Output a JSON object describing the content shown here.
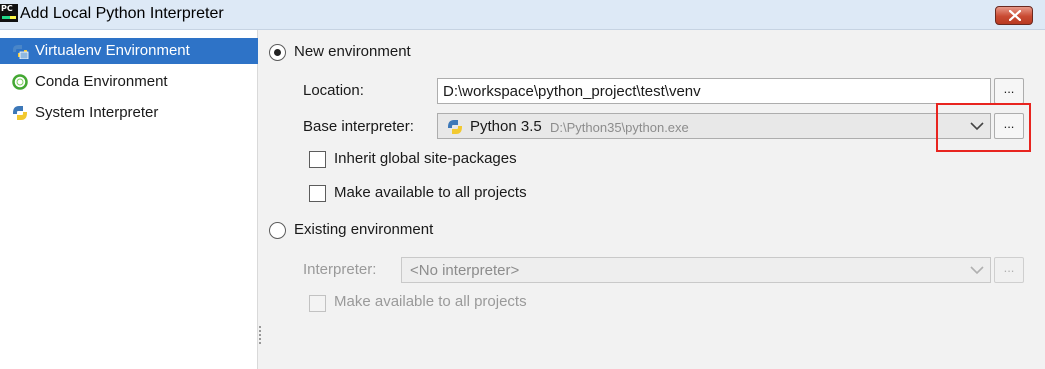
{
  "window": {
    "title": "Add Local Python Interpreter",
    "app_icon_text": "PC"
  },
  "sidebar": {
    "items": [
      {
        "label": "Virtualenv Environment",
        "icon": "virtualenv-icon",
        "selected": true
      },
      {
        "label": "Conda Environment",
        "icon": "conda-icon",
        "selected": false
      },
      {
        "label": "System Interpreter",
        "icon": "python-icon",
        "selected": false
      }
    ]
  },
  "new_env": {
    "radio_label": "New environment",
    "selected": true,
    "location_label": "Location:",
    "location_value": "D:\\workspace\\python_project\\test\\venv",
    "browse_label": "...",
    "base_interpreter_label": "Base interpreter:",
    "base_interpreter_name": "Python 3.5",
    "base_interpreter_path": "D:\\Python35\\python.exe",
    "inherit_label": "Inherit global site-packages",
    "inherit_checked": false,
    "make_available_label": "Make available to all projects",
    "make_available_checked": false
  },
  "existing_env": {
    "radio_label": "Existing environment",
    "selected": false,
    "interpreter_label": "Interpreter:",
    "interpreter_value": "<No interpreter>",
    "browse_label": "...",
    "make_available_label": "Make available to all projects",
    "make_available_checked": false
  },
  "colors": {
    "selection": "#2e73c7",
    "highlight_box": "#e8241f",
    "titlebar": "#dde9f6"
  }
}
